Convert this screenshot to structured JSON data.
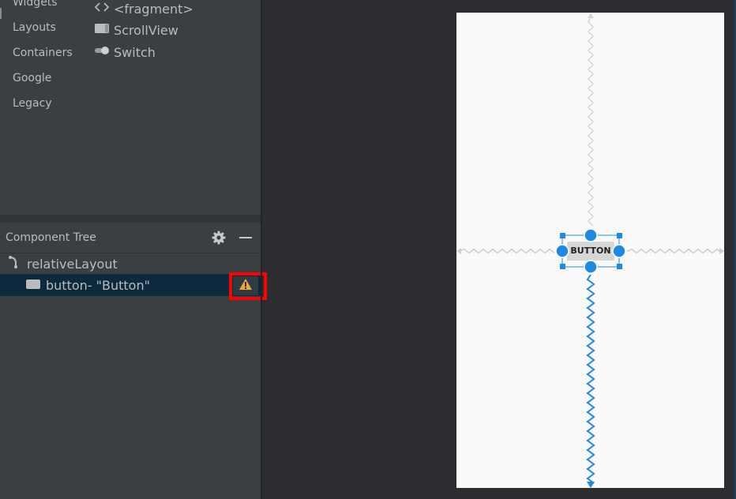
{
  "palette": {
    "categories": [
      "Widgets",
      "Layouts",
      "Containers",
      "Google",
      "Legacy"
    ],
    "items": [
      {
        "label": "<fragment>",
        "icon": "code-brackets-icon"
      },
      {
        "label": "ScrollView",
        "icon": "scrollview-icon"
      },
      {
        "label": "Switch",
        "icon": "switch-icon"
      }
    ]
  },
  "component_tree": {
    "title": "Component Tree",
    "root": {
      "label": "relativeLayout",
      "icon": "relative-layout-icon"
    },
    "child": {
      "label": "button",
      "text": "- \"Button\"",
      "icon": "button-widget-icon",
      "warning": true
    }
  },
  "design": {
    "button_text": "BUTTON"
  },
  "colors": {
    "panel": "#3c3f41",
    "background": "#2b2d30",
    "selection": "#0d293e",
    "accent": "#1e88e5",
    "warning_highlight": "#ff0000"
  }
}
